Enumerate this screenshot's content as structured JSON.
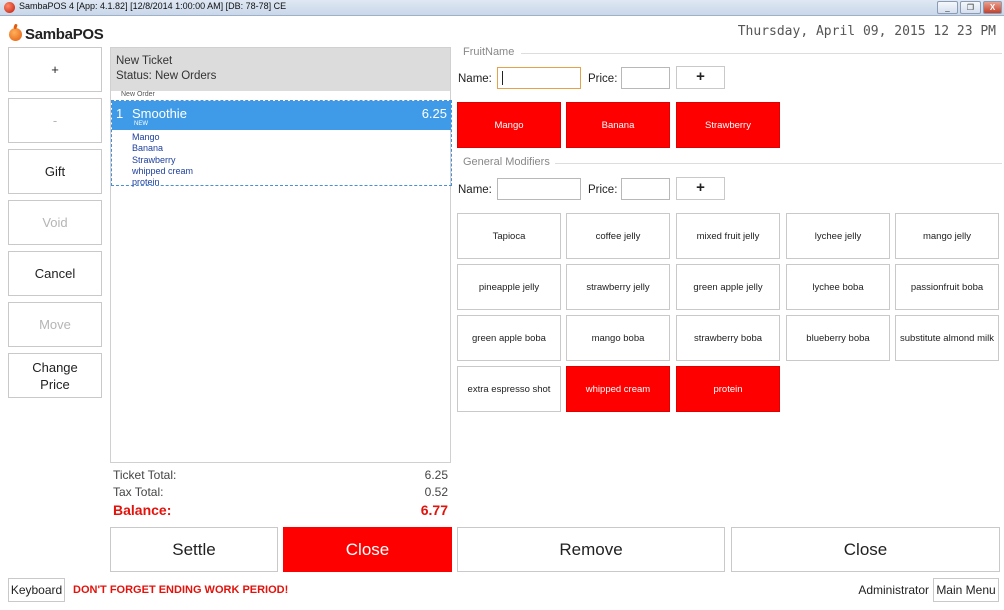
{
  "window": {
    "title": "SambaPOS 4 [App: 4.1.82] [12/8/2014 1:00:00 AM] [DB: 78-78] CE",
    "controls": [
      "_",
      "❐",
      "X"
    ]
  },
  "header": {
    "logo_text": "SambaPOS",
    "datetime": "Thursday, April 09, 2015 12 23 PM"
  },
  "commands": [
    {
      "label": "+",
      "enabled": true
    },
    {
      "label": "-",
      "enabled": false
    },
    {
      "label": "Gift",
      "enabled": true
    },
    {
      "label": "Void",
      "enabled": false
    },
    {
      "label": "Cancel",
      "enabled": true
    },
    {
      "label": "Move",
      "enabled": false
    },
    {
      "label": "Change\nPrice",
      "enabled": true
    }
  ],
  "ticket": {
    "title": "New Ticket",
    "status": "Status: New Orders",
    "group_label": "New Order",
    "order": {
      "qty": "1",
      "name": "Smoothie",
      "price": "6.25",
      "state": "NEW",
      "modifiers": [
        "Mango",
        "Banana",
        "Strawberry",
        "whipped cream",
        "protein"
      ]
    }
  },
  "totals": {
    "ticket_total_label": "Ticket Total:",
    "ticket_total": "6.25",
    "tax_total_label": "Tax Total:",
    "tax_total": "0.52",
    "balance_label": "Balance:",
    "balance": "6.77"
  },
  "fruit_section": {
    "title": "FruitName",
    "name_label": "Name:",
    "name_value": "",
    "price_label": "Price:",
    "price_value": "",
    "add_label": "+",
    "buttons": [
      {
        "label": "Mango",
        "selected": true
      },
      {
        "label": "Banana",
        "selected": true
      },
      {
        "label": "Strawberry",
        "selected": true
      }
    ]
  },
  "general_section": {
    "title": "General Modifiers",
    "name_label": "Name:",
    "name_value": "",
    "price_label": "Price:",
    "price_value": "",
    "add_label": "+",
    "buttons": [
      {
        "label": "Tapioca",
        "selected": false
      },
      {
        "label": "coffee jelly",
        "selected": false
      },
      {
        "label": "mixed fruit jelly",
        "selected": false
      },
      {
        "label": "lychee jelly",
        "selected": false
      },
      {
        "label": "mango jelly",
        "selected": false
      },
      {
        "label": "pineapple jelly",
        "selected": false
      },
      {
        "label": "strawberry jelly",
        "selected": false
      },
      {
        "label": "green apple jelly",
        "selected": false
      },
      {
        "label": "lychee boba",
        "selected": false
      },
      {
        "label": "passionfruit boba",
        "selected": false
      },
      {
        "label": "green apple boba",
        "selected": false
      },
      {
        "label": "mango boba",
        "selected": false
      },
      {
        "label": "strawberry boba",
        "selected": false
      },
      {
        "label": "blueberry boba",
        "selected": false
      },
      {
        "label": "substitute almond milk",
        "selected": false
      },
      {
        "label": "extra espresso shot",
        "selected": false
      },
      {
        "label": "whipped cream",
        "selected": true
      },
      {
        "label": "protein",
        "selected": true
      }
    ]
  },
  "actions": {
    "settle": "Settle",
    "close_red": "Close",
    "remove": "Remove",
    "close": "Close"
  },
  "footer": {
    "keyboard": "Keyboard",
    "warning": "DON'T FORGET ENDING WORK PERIOD!",
    "user": "Administrator",
    "main_menu": "Main Menu"
  },
  "colors": {
    "accent_red": "#ff0000",
    "selected_order_blue": "#3f9be8",
    "balance_red": "#e3120b"
  }
}
